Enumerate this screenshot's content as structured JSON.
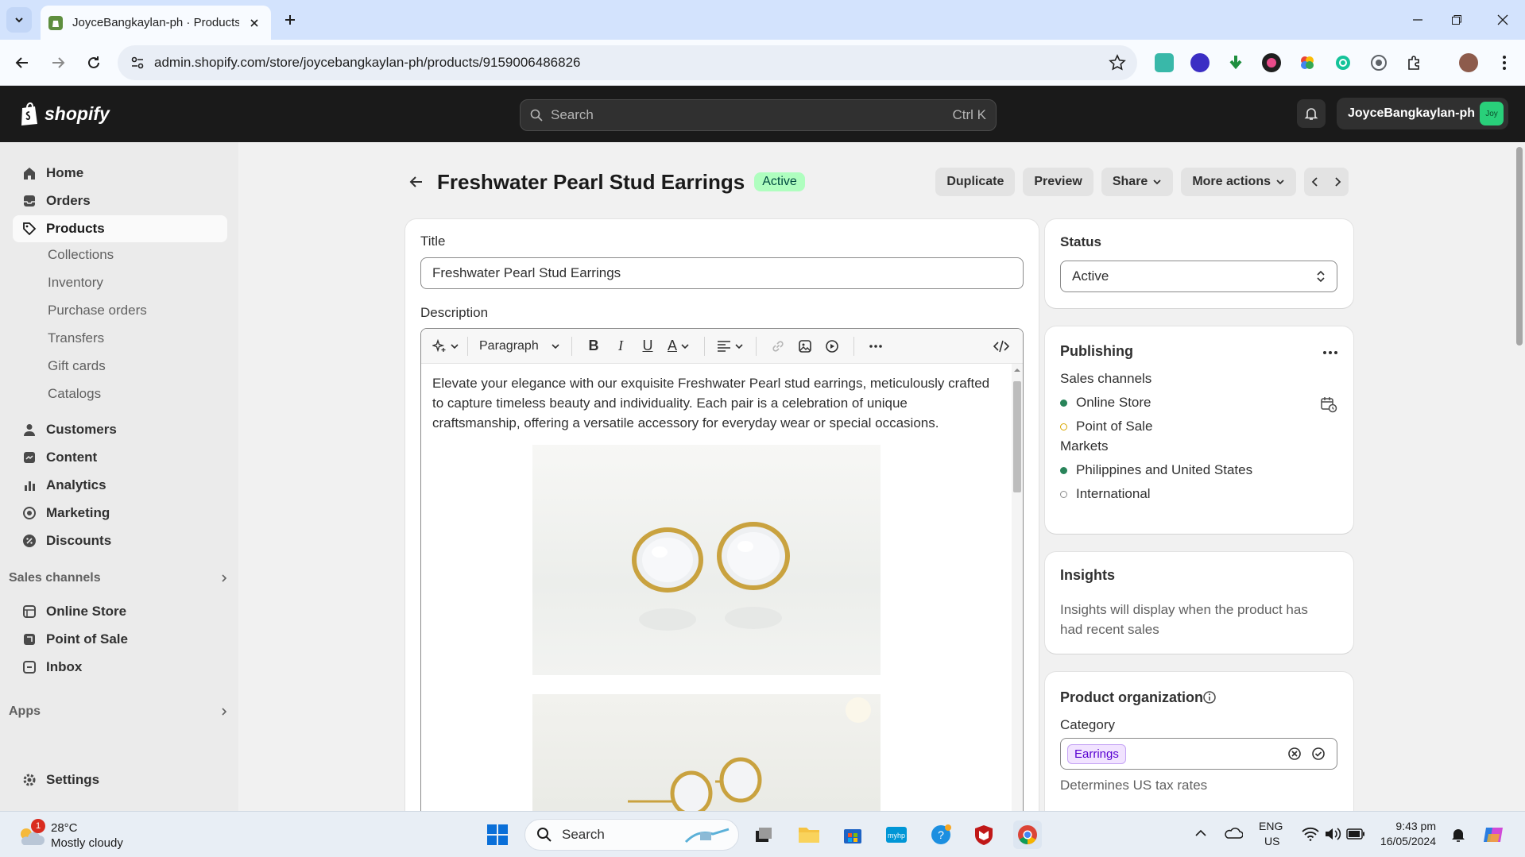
{
  "browser": {
    "tab_title": "JoyceBangkaylan-ph · Products",
    "url": "admin.shopify.com/store/joycebangkaylan-ph/products/9159006486826"
  },
  "topbar": {
    "logo": "shopify",
    "search_placeholder": "Search",
    "search_shortcut": "Ctrl K",
    "store_name": "JoyceBangkaylan-ph",
    "avatar_initials": "Joy"
  },
  "sidebar": {
    "main": [
      "Home",
      "Orders",
      "Products"
    ],
    "products_sub": [
      "Collections",
      "Inventory",
      "Purchase orders",
      "Transfers",
      "Gift cards",
      "Catalogs"
    ],
    "more": [
      "Customers",
      "Content",
      "Analytics",
      "Marketing",
      "Discounts"
    ],
    "sales_channels_label": "Sales channels",
    "channels": [
      "Online Store",
      "Point of Sale",
      "Inbox"
    ],
    "apps_label": "Apps",
    "settings": "Settings"
  },
  "product": {
    "title": "Freshwater Pearl Stud Earrings",
    "status_badge": "Active",
    "actions": {
      "duplicate": "Duplicate",
      "preview": "Preview",
      "share": "Share",
      "more": "More actions"
    },
    "title_label": "Title",
    "title_value": "Freshwater Pearl Stud Earrings",
    "description_label": "Description",
    "editor_paragraph": "Paragraph",
    "description_text": "Elevate your elegance with our exquisite Freshwater Pearl stud earrings, meticulously crafted to capture timeless beauty and individuality. Each pair is a celebration of unique craftsmanship, offering a versatile accessory for everyday wear or special occasions."
  },
  "status_card": {
    "label": "Status",
    "value": "Active"
  },
  "publishing": {
    "title": "Publishing",
    "sales_channels_label": "Sales channels",
    "channels": [
      {
        "name": "Online Store",
        "color": "#29845a",
        "filled": true
      },
      {
        "name": "Point of Sale",
        "color": "#d9a700",
        "filled": false
      }
    ],
    "markets_label": "Markets",
    "markets": [
      {
        "name": "Philippines and United States",
        "color": "#29845a",
        "filled": true
      },
      {
        "name": "International",
        "color": "#8a8a8a",
        "filled": false
      }
    ]
  },
  "insights": {
    "title": "Insights",
    "text": "Insights will display when the product has had recent sales"
  },
  "organization": {
    "title": "Product organization",
    "category_label": "Category",
    "category_chip": "Earrings",
    "help": "Determines US tax rates"
  },
  "taskbar": {
    "weather_temp": "28°C",
    "weather_desc": "Mostly cloudy",
    "weather_badge": "1",
    "search": "Search",
    "lang1": "ENG",
    "lang2": "US",
    "time": "9:43 pm",
    "date": "16/05/2024"
  }
}
